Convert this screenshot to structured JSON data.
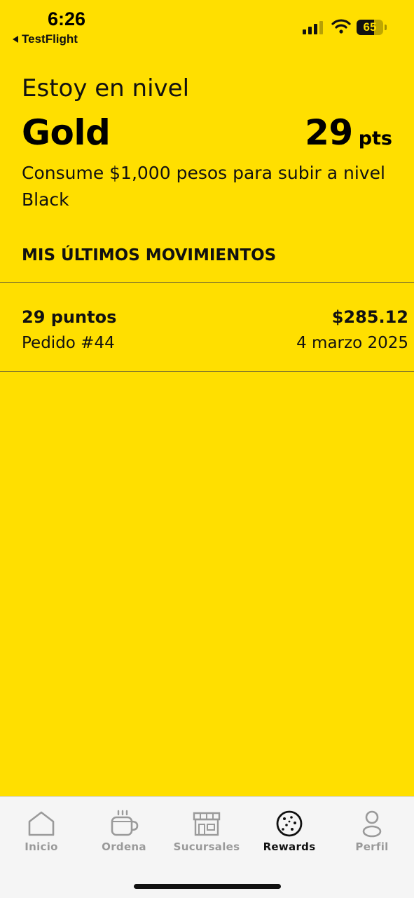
{
  "status_bar": {
    "time": "6:26",
    "back_app": "TestFlight",
    "battery_percent": 65,
    "battery_label": "65"
  },
  "rewards": {
    "level_prefix": "Estoy en nivel",
    "level_name": "Gold",
    "points_value": "29",
    "points_unit": "pts",
    "upgrade_message": "Consume $1,000 pesos para subir a nivel Black",
    "section_title": "MIS ÚLTIMOS MOVIMIENTOS",
    "movements": [
      {
        "points": "29 puntos",
        "amount": "$285.12",
        "order": "Pedido #44",
        "date": "4 marzo 2025"
      }
    ]
  },
  "tab_bar": {
    "tabs": [
      {
        "label": "Inicio",
        "icon": "home-icon"
      },
      {
        "label": "Ordena",
        "icon": "coffee-cup-icon"
      },
      {
        "label": "Sucursales",
        "icon": "store-icon"
      },
      {
        "label": "Rewards",
        "icon": "cookie-icon"
      },
      {
        "label": "Perfil",
        "icon": "person-icon"
      }
    ],
    "active": "Rewards"
  },
  "colors": {
    "background": "#FFDF00",
    "tab_bar_bg": "#F5F5F5",
    "inactive_tab": "#9a9a9a",
    "active_tab": "#111111"
  }
}
